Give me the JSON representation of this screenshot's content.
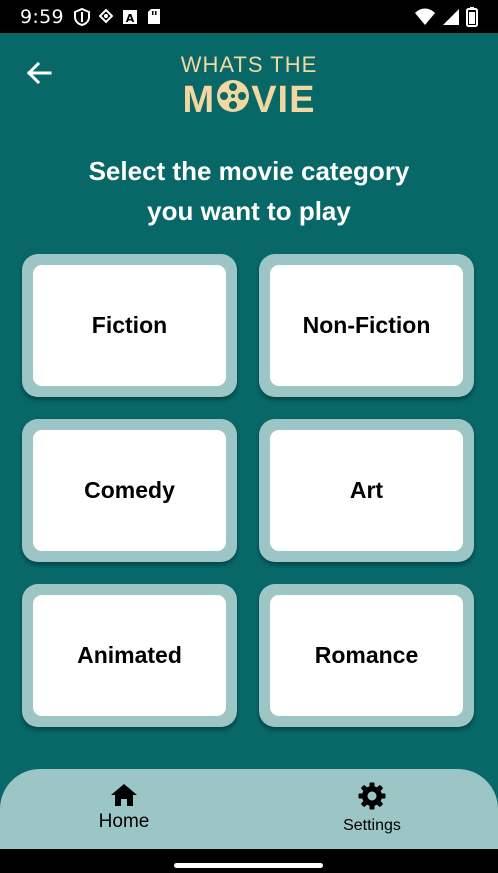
{
  "status_bar": {
    "time": "9:59",
    "icons": [
      "shield-icon",
      "data-saver-icon",
      "a-box-icon",
      "sd-card-icon",
      "wifi-icon",
      "signal-icon",
      "battery-icon"
    ]
  },
  "header": {
    "back_icon": "arrow-left-icon",
    "logo_top": "WHATS THE",
    "logo_bottom_left": "M",
    "logo_bottom_right": "VIE",
    "logo_reel_icon": "film-reel-icon"
  },
  "prompt": {
    "line1": "Select the movie category",
    "line2": "you want to play"
  },
  "categories": [
    {
      "label": "Fiction"
    },
    {
      "label": "Non-Fiction"
    },
    {
      "label": "Comedy"
    },
    {
      "label": "Art"
    },
    {
      "label": "Animated"
    },
    {
      "label": "Romance"
    }
  ],
  "bottom_nav": {
    "home_label": "Home",
    "home_icon": "home-icon",
    "settings_label": "Settings",
    "settings_icon": "gear-icon"
  },
  "colors": {
    "background": "#086868",
    "accent": "#F2D7A0",
    "card_border": "#9CC6C6",
    "card": "#FFFFFF",
    "nav": "#9CC6C6"
  }
}
